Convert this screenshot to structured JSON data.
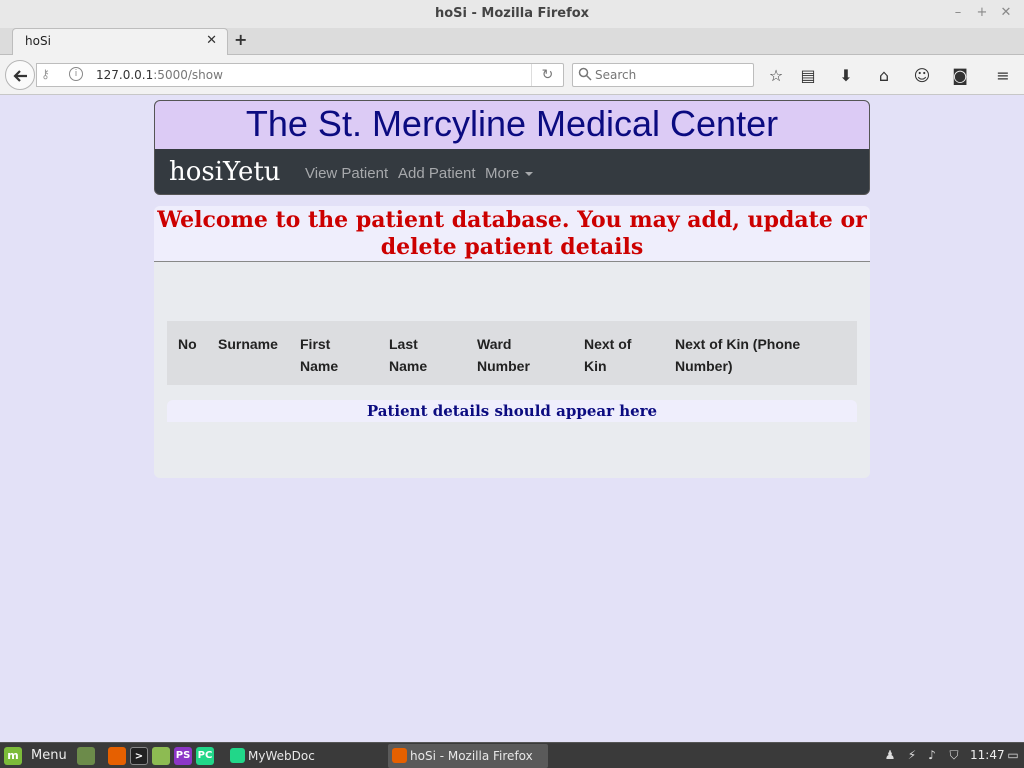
{
  "window": {
    "title": "hoSi - Mozilla Firefox",
    "controls": {
      "minimize": "–",
      "maximize": "+",
      "close": "✕"
    }
  },
  "tabs": [
    {
      "label": "hoSi",
      "close_icon": "close-icon"
    }
  ],
  "newtab_label": "+",
  "navbar": {
    "url_host": "127.0.0.1",
    "url_path": ":5000/show",
    "search_placeholder": "Search"
  },
  "site": {
    "title": "The St. Mercyline Medical Center",
    "brand": "hosiYetu",
    "nav": {
      "view_patient": "View Patient",
      "add_patient": "Add Patient",
      "more": "More"
    },
    "welcome": "Welcome to the patient database. You may add, update or delete patient details",
    "table": {
      "headers": {
        "no": "No",
        "surname": "Surname",
        "first_name": "First Name",
        "last_name": "Last Name",
        "ward_number": "Ward Number",
        "next_of_kin": "Next of Kin",
        "next_of_kin_phone": "Next of Kin (Phone Number)"
      },
      "empty_message": "Patient details should appear here"
    }
  },
  "taskbar": {
    "menu_label": "Menu",
    "tasks": [
      {
        "label": "MyWebDoc [~/Down..."
      },
      {
        "label": "hoSi - Mozilla Firefox"
      }
    ],
    "clock": "11:47"
  },
  "colors": {
    "page_bg": "#e3e1f7",
    "title_text": "#0b0b80",
    "welcome_text": "#cc0000",
    "nav_bg": "#343a40"
  }
}
